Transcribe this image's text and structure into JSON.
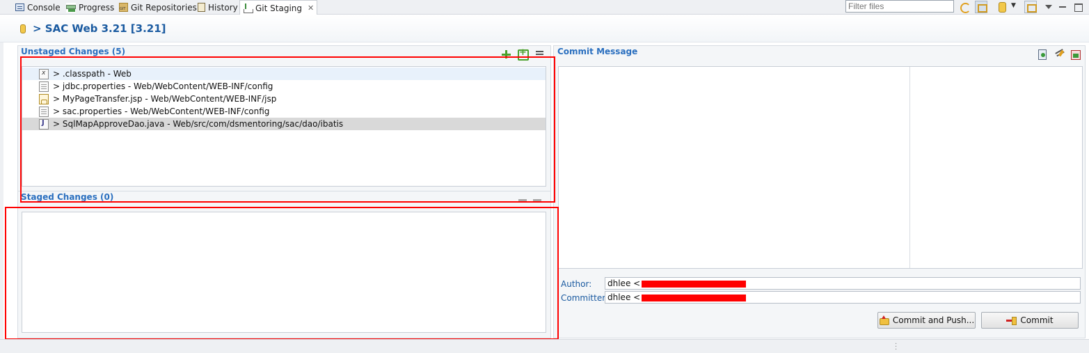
{
  "tabs": [
    {
      "label": "Console",
      "icon": "console-icon"
    },
    {
      "label": "Progress",
      "icon": "progress-icon"
    },
    {
      "label": "Git Repositories",
      "icon": "git-repositories-icon"
    },
    {
      "label": "History",
      "icon": "history-icon"
    },
    {
      "label": "Git Staging",
      "icon": "git-staging-icon",
      "active": true
    }
  ],
  "toolbar": {
    "filter_placeholder": "Filter files"
  },
  "header": {
    "title": "> SAC Web 3.21 [3.21]"
  },
  "unstaged": {
    "title": "Unstaged Changes (5)",
    "files": [
      {
        "name": "> .classpath - Web",
        "icon": "xml-file-icon"
      },
      {
        "name": "> jdbc.properties - Web/WebContent/WEB-INF/config",
        "icon": "properties-file-icon"
      },
      {
        "name": "> MyPageTransfer.jsp - Web/WebContent/WEB-INF/jsp",
        "icon": "jsp-file-icon"
      },
      {
        "name": "> sac.properties - Web/WebContent/WEB-INF/config",
        "icon": "properties-file-icon"
      },
      {
        "name": "> SqlMapApproveDao.java - Web/src/com/dsmentoring/sac/dao/ibatis",
        "icon": "java-file-icon"
      }
    ]
  },
  "staged": {
    "title": "Staged Changes (0)"
  },
  "commit": {
    "title": "Commit Message",
    "author_label": "Author:",
    "author_value": "dhlee <",
    "committer_label": "Committer:",
    "committer_value": "dhlee <",
    "commit_and_push_label": "Commit and Push...",
    "commit_label": "Commit"
  },
  "colors": {
    "section_title": "#2a6fbf",
    "header_title": "#1a5aa0",
    "annotation": "#ff0000"
  }
}
